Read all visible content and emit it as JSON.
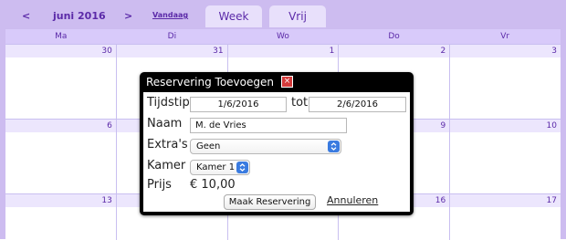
{
  "nav": {
    "prev": "<",
    "month": "juni 2016",
    "next": ">",
    "today": "Vandaag"
  },
  "tabs": {
    "week": "Week",
    "month": "Vrij"
  },
  "weekdays": [
    "Ma",
    "Di",
    "Wo",
    "Do",
    "Vr"
  ],
  "weeks": [
    [
      "30",
      "31",
      "1",
      "2",
      "3"
    ],
    [
      "6",
      "",
      "",
      "9",
      "10"
    ],
    [
      "13",
      "",
      "",
      "16",
      "17"
    ]
  ],
  "dialog": {
    "title": "Reservering Toevoegen",
    "close": "×",
    "time_label": "Tijdstip",
    "from_date": "1/6/2016",
    "to_label": "tot",
    "to_date": "2/6/2016",
    "name_label": "Naam",
    "name_value": "M. de Vries",
    "extras_label": "Extra's",
    "extras_value": "Geen",
    "room_label": "Kamer",
    "room_value": "Kamer 1",
    "price_label": "Prijs",
    "price_value": "€ 10,00",
    "submit": "Maak Reservering",
    "cancel": "Annuleren"
  }
}
